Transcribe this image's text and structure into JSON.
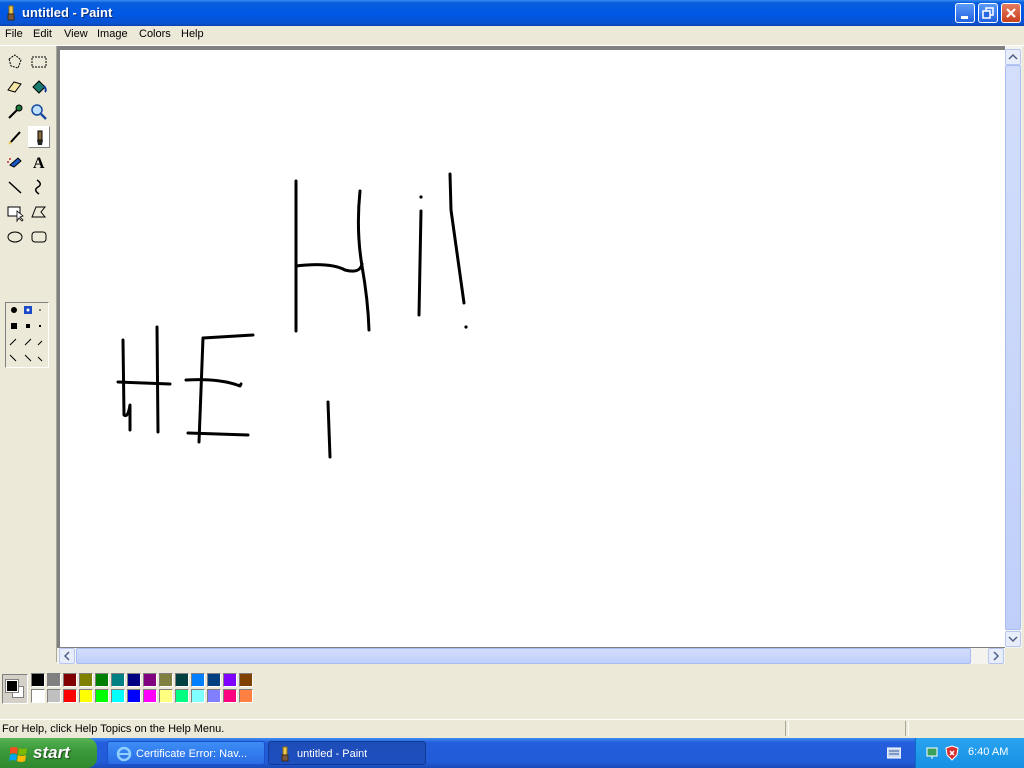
{
  "window": {
    "title": "untitled - Paint"
  },
  "menu": [
    "File",
    "Edit",
    "View",
    "Image",
    "Colors",
    "Help"
  ],
  "tools": [
    {
      "name": "free-form-select"
    },
    {
      "name": "select"
    },
    {
      "name": "eraser"
    },
    {
      "name": "fill-with-color"
    },
    {
      "name": "pick-color"
    },
    {
      "name": "magnifier"
    },
    {
      "name": "pencil"
    },
    {
      "name": "brush"
    },
    {
      "name": "airbrush"
    },
    {
      "name": "text"
    },
    {
      "name": "line"
    },
    {
      "name": "curve"
    },
    {
      "name": "rectangle"
    },
    {
      "name": "polygon"
    },
    {
      "name": "ellipse"
    },
    {
      "name": "rounded-rectangle"
    }
  ],
  "selected_tool": "brush",
  "text_tool_glyph": "A",
  "palette": {
    "foreground": "#000000",
    "background": "#FFFFFF",
    "row1": [
      "#000000",
      "#808080",
      "#800000",
      "#808000",
      "#008000",
      "#008080",
      "#000080",
      "#800080",
      "#808040",
      "#004040",
      "#0080FF",
      "#004080",
      "#8000FF",
      "#804000"
    ],
    "row2": [
      "#FFFFFF",
      "#C0C0C0",
      "#FF0000",
      "#FFFF00",
      "#00FF00",
      "#00FFFF",
      "#0000FF",
      "#FF00FF",
      "#FFFF80",
      "#00FF80",
      "#80FFFF",
      "#8080FF",
      "#FF0080",
      "#FF8040"
    ]
  },
  "status": {
    "message": "For Help, click Help Topics on the Help Menu."
  },
  "taskbar": {
    "start_label": "start",
    "tasks": [
      {
        "label": "Certificate Error: Nav..."
      },
      {
        "label": "untitled - Paint"
      }
    ],
    "time": "6:40 AM"
  }
}
